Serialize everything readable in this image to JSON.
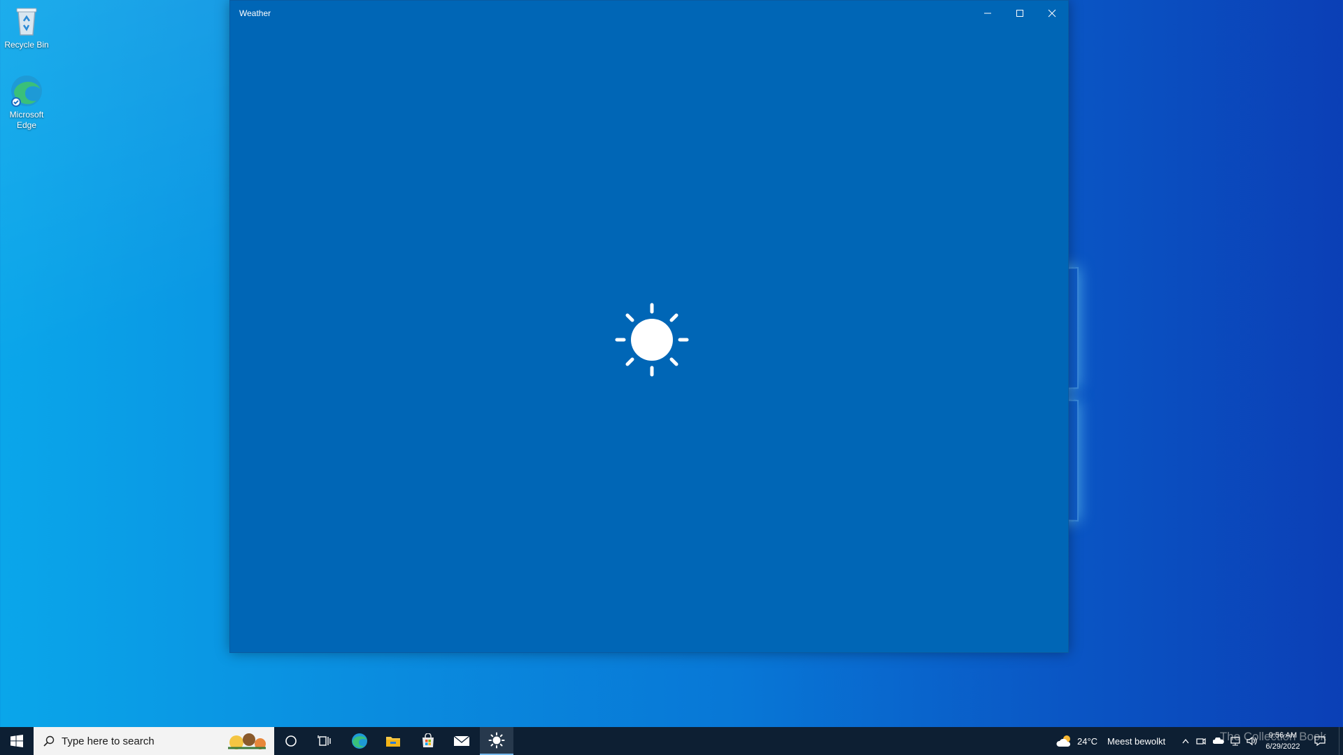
{
  "desktop": {
    "icons": [
      {
        "label": "Recycle Bin",
        "icon": "recycle-bin-icon"
      },
      {
        "label": "Microsoft Edge",
        "icon": "edge-icon"
      }
    ]
  },
  "window": {
    "title": "Weather",
    "controls": [
      "minimize-icon",
      "maximize-icon",
      "close-icon"
    ],
    "splash_icon": "sun-icon",
    "background_color": "#0066b6"
  },
  "taskbar": {
    "search_placeholder": "Type here to search",
    "pinned": [
      "cortana-icon",
      "task-view-icon",
      "edge-icon",
      "file-explorer-icon",
      "store-icon",
      "mail-icon",
      "weather-icon"
    ],
    "active_app": "weather-icon",
    "weather_widget": {
      "temperature": "24°C",
      "condition": "Meest bewolkt",
      "icon": "cloud-sun-icon"
    },
    "clock": {
      "time": "9:56 AM",
      "date": "6/29/2022"
    },
    "watermark": "The Collection Book",
    "tray_icons": [
      "chevron-up-icon",
      "meet-icon",
      "onedrive-icon",
      "network-icon",
      "volume-icon",
      "notification-icon"
    ]
  },
  "colors": {
    "taskbar": "#0d1f33",
    "accent": "#0078d7"
  }
}
